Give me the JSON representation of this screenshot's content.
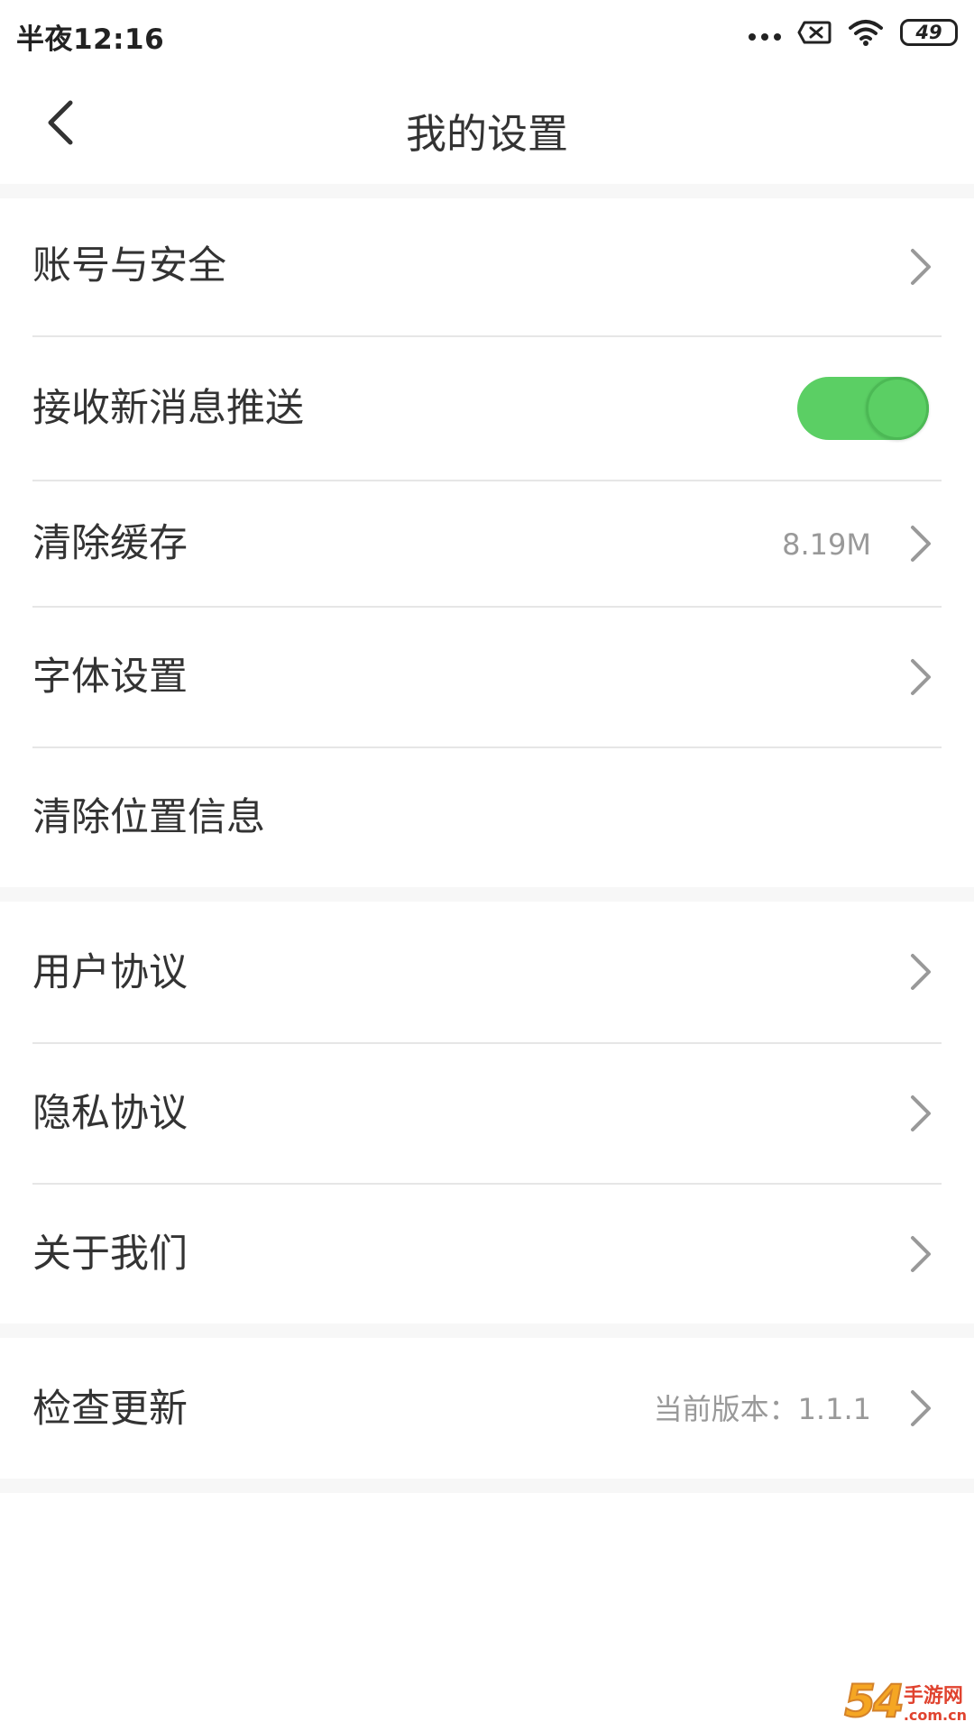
{
  "status_bar": {
    "time": "半夜12:16",
    "battery": "49",
    "icons": [
      "more-dots-icon",
      "no-sim-icon",
      "wifi-icon",
      "battery-icon"
    ]
  },
  "header": {
    "title": "我的设置",
    "back_icon": "back-chevron-icon"
  },
  "settings": {
    "account_security": {
      "label": "账号与安全"
    },
    "push_notifications": {
      "label": "接收新消息推送",
      "enabled": true
    },
    "clear_cache": {
      "label": "清除缓存",
      "value": "8.19M"
    },
    "font_settings": {
      "label": "字体设置"
    },
    "clear_location": {
      "label": "清除位置信息"
    },
    "user_agreement": {
      "label": "用户协议"
    },
    "privacy_policy": {
      "label": "隐私协议"
    },
    "about_us": {
      "label": "关于我们"
    },
    "check_update": {
      "label": "检查更新",
      "value": "当前版本：1.1.1"
    }
  },
  "watermark": {
    "number": "54",
    "name": "手游网",
    "domain": ".com.cn"
  },
  "colors": {
    "toggle_on": "#5bcf64",
    "text_primary": "#333333",
    "text_secondary": "#999999",
    "divider": "#e6e6e6",
    "group_gap": "#f7f7f7"
  }
}
